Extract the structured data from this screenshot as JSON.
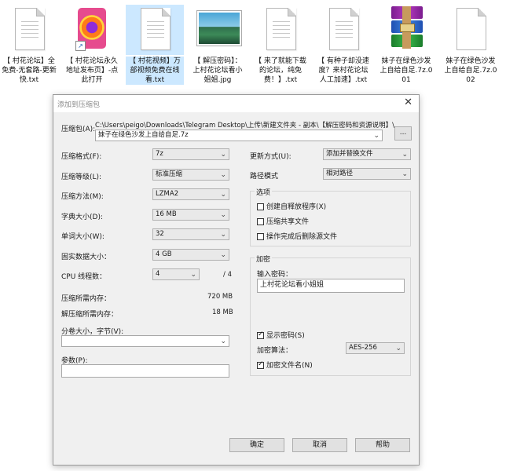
{
  "desktop": {
    "files": [
      {
        "label": "【 村花论坛】全免费-无套路-更新快.txt",
        "icon": "text-file-icon"
      },
      {
        "label": "【 村花论坛永久地址发布页】-点此打开",
        "icon": "firefox-shortcut-icon"
      },
      {
        "label": "【 村花视频】万部视频免费在线看.txt",
        "icon": "text-file-icon"
      },
      {
        "label": "【 解压密码】：上村花论坛看小姐姐.jpg",
        "icon": "image-file-icon"
      },
      {
        "label": "【 来了就能下载的论坛，纯免费！】.txt",
        "icon": "text-file-icon"
      },
      {
        "label": "【 有种子却没速度？来村花论坛人工加速】.txt",
        "icon": "text-file-icon"
      },
      {
        "label": "妹子在绿色沙发上自给自足.7z.001",
        "icon": "winrar-archive-icon"
      },
      {
        "label": "妹子在绿色沙发上自给自足.7z.002",
        "icon": "blank-file-icon"
      }
    ]
  },
  "dialog": {
    "title": "添加到压缩包",
    "archive_label": "压缩包(A):",
    "archive_path": "C:\\Users\\peigo\\Downloads\\Telegram Desktop\\上传\\新建文件夹 - 副本\\【解压密码和资源说明】\\",
    "archive_name": "妹子在绿色沙发上自给自足.7z",
    "browse_label": "...",
    "left": {
      "format_label": "压缩格式(F):",
      "format_value": "7z",
      "level_label": "压缩等级(L):",
      "level_value": "标准压缩",
      "method_label": "压缩方法(M):",
      "method_value": "LZMA2",
      "dict_label": "字典大小(D):",
      "dict_value": "16 MB",
      "word_label": "单词大小(W):",
      "word_value": "32",
      "solid_label": "固实数据大小：",
      "solid_value": "4 GB",
      "threads_label": "CPU 线程数：",
      "threads_value": "4",
      "threads_max": "/ 4",
      "mem_comp_label": "压缩所需内存：",
      "mem_comp_value": "720 MB",
      "mem_decomp_label": "解压缩所需内存：",
      "mem_decomp_value": "18 MB",
      "volume_label": "分卷大小，字节(V):",
      "volume_value": "",
      "params_label": "参数(P):",
      "params_value": ""
    },
    "right": {
      "update_label": "更新方式(U):",
      "update_value": "添加并替换文件",
      "pathmode_label": "路径模式",
      "pathmode_value": "相对路径",
      "options_title": "选项",
      "opt_sfx": "创建自释放程序(X)",
      "opt_shared": "压缩共享文件",
      "opt_delete": "操作完成后删除源文件",
      "encrypt_title": "加密",
      "password_label": "输入密码：",
      "password_value": "上村花论坛看小姐姐",
      "show_password": "显示密码(S)",
      "enc_method_label": "加密算法：",
      "enc_method_value": "AES-256",
      "enc_filenames": "加密文件名(N)"
    },
    "buttons": {
      "ok": "确定",
      "cancel": "取消",
      "help": "帮助"
    }
  }
}
